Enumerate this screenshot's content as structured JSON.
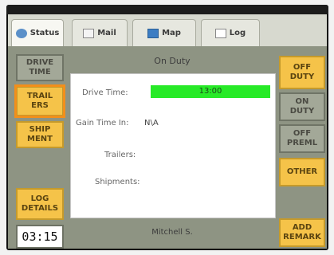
{
  "topbar": {
    "text": ""
  },
  "tabs": [
    {
      "label": "Status",
      "icon": "status-icon"
    },
    {
      "label": "Mail",
      "icon": "mail-icon"
    },
    {
      "label": "Map",
      "icon": "map-icon"
    },
    {
      "label": "Log",
      "icon": "log-icon"
    }
  ],
  "left_buttons": [
    {
      "label": "DRIVE\nTIME"
    },
    {
      "label": "TRAIL\nERS"
    },
    {
      "label": "SHIP\nMENT"
    },
    {
      "label": "LOG\nDETAILS"
    }
  ],
  "right_buttons": [
    {
      "label": "OFF\nDUTY"
    },
    {
      "label": "ON\nDUTY"
    },
    {
      "label": "OFF\nPREML"
    },
    {
      "label": "OTHER"
    },
    {
      "label": "ADD\nREMARK"
    }
  ],
  "status": {
    "title": "On Duty",
    "drive_time_label": "Drive Time:",
    "drive_time_value": "13:00",
    "gain_time_label": "Gain Time In:",
    "gain_time_value": "N\\A",
    "trailers_label": "Trailers:",
    "shipments_label": "Shipments:"
  },
  "footer": {
    "driver_name": "Mitchell S.",
    "clock": "03:15"
  },
  "colors": {
    "accent_yellow": "#f5c349",
    "selected_outline": "#f28f1a",
    "drive_bar": "#27ea27",
    "screen_bg": "#8e9483"
  }
}
